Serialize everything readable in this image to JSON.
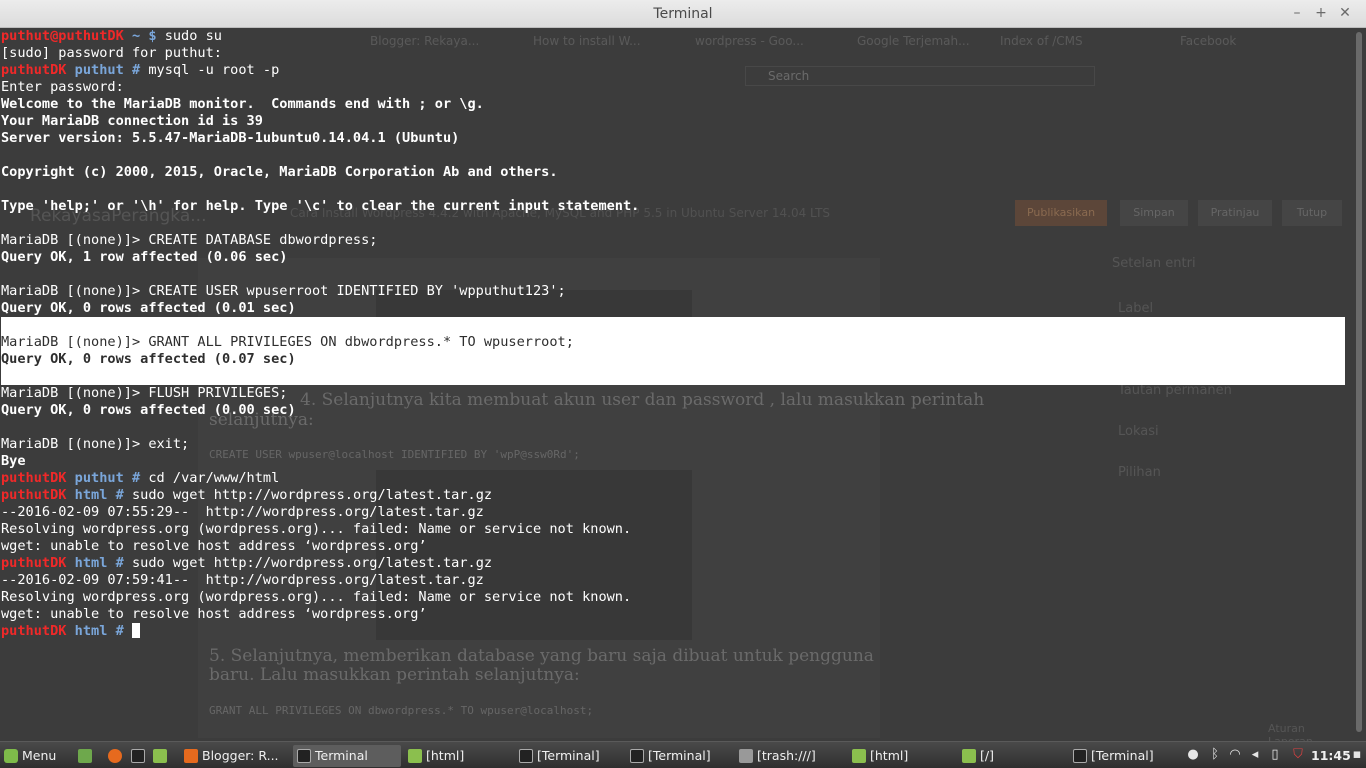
{
  "window": {
    "title": "Terminal"
  },
  "terminal": {
    "lines": [
      {
        "segments": [
          {
            "t": "puthut@puthutDK",
            "s": "red"
          },
          {
            "t": " ~ $ ",
            "s": "blue"
          },
          {
            "t": "sudo su",
            "s": ""
          }
        ]
      },
      {
        "segments": [
          {
            "t": "[sudo] password for puthut:",
            "s": ""
          }
        ]
      },
      {
        "segments": [
          {
            "t": "puthutDK",
            "s": "red"
          },
          {
            "t": " puthut # ",
            "s": "blue"
          },
          {
            "t": "mysql -u root -p",
            "s": ""
          }
        ]
      },
      {
        "segments": [
          {
            "t": "Enter password:",
            "s": ""
          }
        ]
      },
      {
        "segments": [
          {
            "t": "Welcome to the MariaDB monitor.  Commands end with ; or \\g.",
            "s": "bold"
          }
        ]
      },
      {
        "segments": [
          {
            "t": "Your MariaDB connection id is 39",
            "s": "bold"
          }
        ]
      },
      {
        "segments": [
          {
            "t": "Server version: 5.5.47-MariaDB-1ubuntu0.14.04.1 (Ubuntu)",
            "s": "bold"
          }
        ]
      },
      {
        "segments": []
      },
      {
        "segments": [
          {
            "t": "Copyright (c) 2000, 2015, Oracle, MariaDB Corporation Ab and others.",
            "s": "bold"
          }
        ]
      },
      {
        "segments": []
      },
      {
        "segments": [
          {
            "t": "Type 'help;' or '\\h' for help. Type '\\c' to clear the current input statement.",
            "s": "bold"
          }
        ]
      },
      {
        "segments": []
      },
      {
        "segments": [
          {
            "t": "MariaDB [(none)]> CREATE DATABASE dbwordpress;",
            "s": ""
          }
        ]
      },
      {
        "segments": [
          {
            "t": "Query OK, 1 row affected (0.06 sec)",
            "s": "bold"
          }
        ]
      },
      {
        "segments": []
      },
      {
        "segments": [
          {
            "t": "MariaDB [(none)]> CREATE USER wpuserroot IDENTIFIED BY 'wpputhut123';",
            "s": ""
          }
        ]
      },
      {
        "segments": [
          {
            "t": "Query OK, 0 rows affected (0.01 sec)",
            "s": "bold"
          }
        ]
      },
      {
        "segments": [],
        "hl": true
      },
      {
        "segments": [
          {
            "t": "MariaDB [(none)]> GRANT ALL PRIVILEGES ON dbwordpress.* TO wpuserroot;",
            "s": ""
          }
        ],
        "hl": true
      },
      {
        "segments": [
          {
            "t": "Query OK, 0 rows affected (0.07 sec)",
            "s": "bold"
          }
        ],
        "hl": true
      },
      {
        "segments": [],
        "hl": true
      },
      {
        "segments": [
          {
            "t": "MariaDB [(none)]> FLUSH PRIVILEGES;",
            "s": ""
          }
        ]
      },
      {
        "segments": [
          {
            "t": "Query OK, 0 rows affected (0.00 sec)",
            "s": "bold"
          }
        ]
      },
      {
        "segments": []
      },
      {
        "segments": [
          {
            "t": "MariaDB [(none)]> exit;",
            "s": ""
          }
        ]
      },
      {
        "segments": [
          {
            "t": "Bye",
            "s": "bold"
          }
        ]
      },
      {
        "segments": [
          {
            "t": "puthutDK",
            "s": "red"
          },
          {
            "t": " puthut # ",
            "s": "blue"
          },
          {
            "t": "cd /var/www/html",
            "s": ""
          }
        ]
      },
      {
        "segments": [
          {
            "t": "puthutDK",
            "s": "red"
          },
          {
            "t": " html # ",
            "s": "blue"
          },
          {
            "t": "sudo wget http://wordpress.org/latest.tar.gz",
            "s": ""
          }
        ]
      },
      {
        "segments": [
          {
            "t": "--2016-02-09 07:55:29--  http://wordpress.org/latest.tar.gz",
            "s": ""
          }
        ]
      },
      {
        "segments": [
          {
            "t": "Resolving wordpress.org (wordpress.org)... failed: Name or service not known.",
            "s": ""
          }
        ]
      },
      {
        "segments": [
          {
            "t": "wget: unable to resolve host address ‘wordpress.org’",
            "s": ""
          }
        ]
      },
      {
        "segments": [
          {
            "t": "puthutDK",
            "s": "red"
          },
          {
            "t": " html # ",
            "s": "blue"
          },
          {
            "t": "sudo wget http://wordpress.org/latest.tar.gz",
            "s": ""
          }
        ]
      },
      {
        "segments": [
          {
            "t": "--2016-02-09 07:59:41--  http://wordpress.org/latest.tar.gz",
            "s": ""
          }
        ]
      },
      {
        "segments": [
          {
            "t": "Resolving wordpress.org (wordpress.org)... failed: Name or service not known.",
            "s": ""
          }
        ]
      },
      {
        "segments": [
          {
            "t": "wget: unable to resolve host address ‘wordpress.org’",
            "s": ""
          }
        ]
      },
      {
        "segments": [
          {
            "t": "puthutDK",
            "s": "red"
          },
          {
            "t": " html # ",
            "s": "blue"
          }
        ],
        "cursor": true
      }
    ]
  },
  "background_window": {
    "tabs": [
      "Blogger: Rekaya...",
      "How to install W...",
      "wordpress - Goo...",
      "Google Terjemah...",
      "Index of /CMS",
      "Facebook"
    ],
    "search_placeholder": "Search",
    "blog_title": "RekayasaPerangka...",
    "post_title": "Cara Install Wordpress 4.4.2 with Apache, MySQL and PHP 5.5 in Ubuntu Server 14.04 LTS",
    "buttons": [
      "Publikasikan",
      "Simpan",
      "Pratinjau",
      "Tutup"
    ],
    "sidebar": [
      "Setelan entri",
      "Label",
      "Tautan permanen",
      "Lokasi",
      "Pilihan"
    ],
    "body_lines": [
      "4. Selanjutnya kita membuat akun user dan password , lalu masukkan perintah",
      "selanjutnya:",
      "CREATE USER wpuser@localhost IDENTIFIED BY 'wpP@ssw0Rd';",
      "5. Selanjutnya, memberikan database yang baru saja dibuat untuk pengguna",
      "baru. Lalu masukkan perintah selanjutnya:",
      "GRANT ALL PRIVILEGES ON dbwordpress.* TO wpuser@localhost;"
    ],
    "footer": "Aturan Laporan"
  },
  "taskbar": {
    "menu_label": "Menu",
    "tasks": [
      {
        "label": "Blogger: R...",
        "icon": "firefox-icon",
        "active": false
      },
      {
        "label": "Terminal",
        "icon": "terminal-icon",
        "active": true
      },
      {
        "label": "[html]",
        "icon": "folder-icon",
        "active": false
      },
      {
        "label": "[Terminal]",
        "icon": "terminal-icon",
        "active": false
      },
      {
        "label": "[Terminal]",
        "icon": "terminal-icon",
        "active": false
      },
      {
        "label": "[trash:///]",
        "icon": "trash-icon",
        "active": false
      },
      {
        "label": "[html]",
        "icon": "folder-icon",
        "active": false
      },
      {
        "label": "[/]",
        "icon": "folder-icon",
        "active": false
      },
      {
        "label": "[Terminal]",
        "icon": "terminal-icon",
        "active": false
      }
    ],
    "clock": "11:45"
  },
  "colors": {
    "prompt_red": "#ef2929",
    "prompt_blue": "#7aa6da",
    "terminal_bg": "#3c3c3c"
  }
}
